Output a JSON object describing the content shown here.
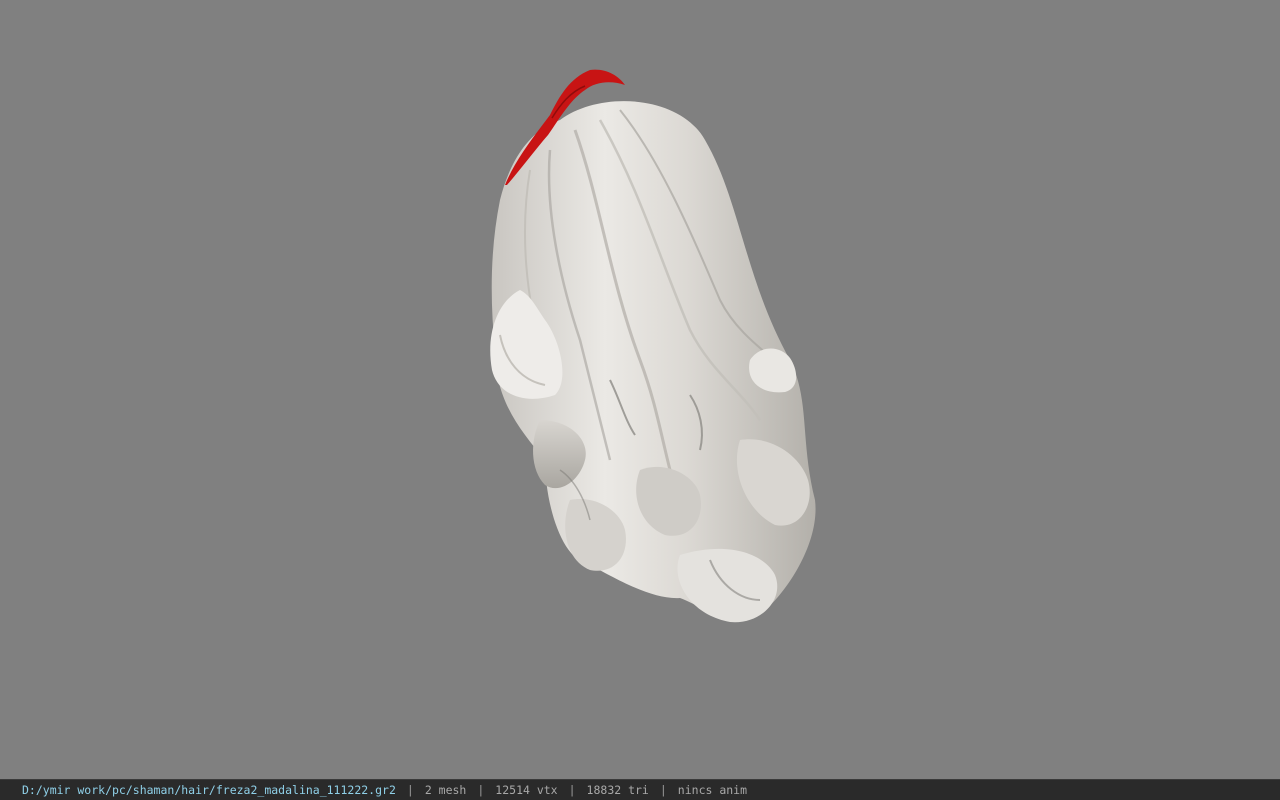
{
  "viewport": {
    "background": "#808080",
    "model": "hair-mesh"
  },
  "colors": {
    "hair": "#e2e0dc",
    "hair_shadow": "#b7b4ae",
    "ribbon": "#c81414",
    "path_text": "#8fd0e8",
    "status_text": "#a8a8a8"
  },
  "statusbar": {
    "path": "D:/ymir work/pc/shaman/hair/freza2_madalina_111222.gr2",
    "separator": "|",
    "mesh": "2 mesh",
    "vtx": "12514 vtx",
    "tri": "18832 tri",
    "anim": "nincs anim"
  }
}
